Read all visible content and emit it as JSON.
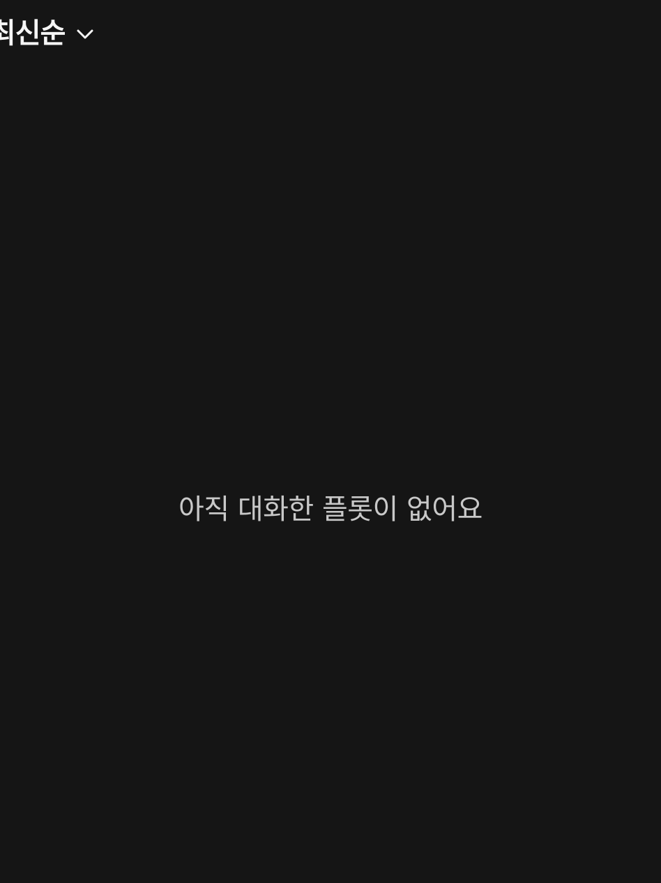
{
  "sort": {
    "selected_label": "최신순",
    "icon": "chevron-down-icon"
  },
  "empty_state": {
    "message": "아직 대화한 플롯이 없어요"
  }
}
